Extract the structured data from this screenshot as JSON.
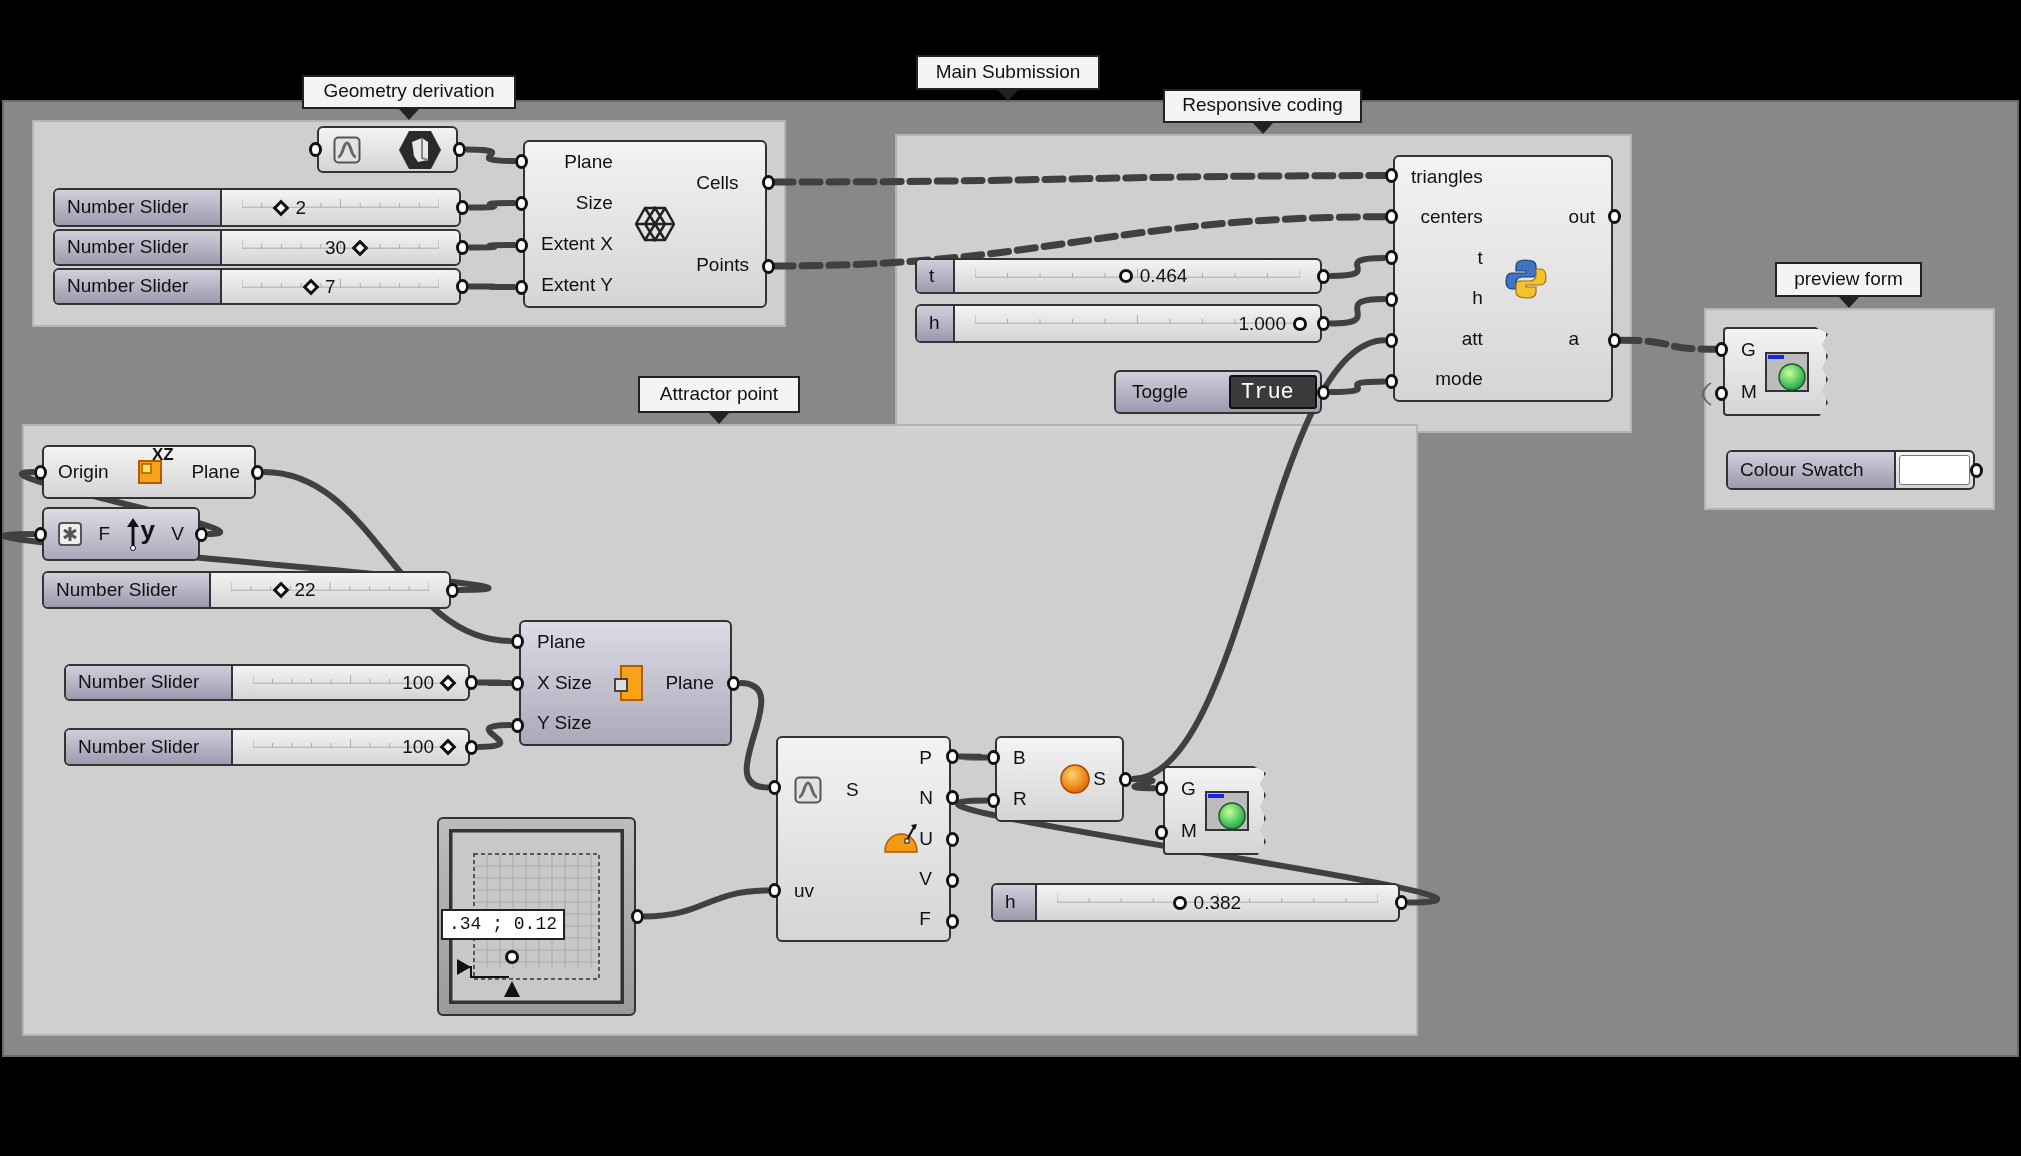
{
  "canvas": {
    "groups": [
      {
        "label": "Main Submission"
      },
      {
        "label": "Geometry derivation"
      },
      {
        "label": "Responsive coding"
      },
      {
        "label": "preview form"
      },
      {
        "label": "Attractor point"
      }
    ],
    "nodes": [
      {
        "kind": "param"
      },
      {
        "kind": "int_slider",
        "label": "Number Slider",
        "value": "2"
      },
      {
        "kind": "int_slider",
        "label": "Number Slider",
        "value": "30"
      },
      {
        "kind": "int_slider",
        "label": "Number Slider",
        "value": "7"
      },
      {
        "kind": "component",
        "inputs": [
          "Plane",
          "Size",
          "Extent X",
          "Extent Y"
        ],
        "outputs": [
          "Cells",
          "Points"
        ]
      },
      {
        "kind": "float_slider",
        "label": "t",
        "value": "0.464"
      },
      {
        "kind": "float_slider",
        "label": "h",
        "value": "1.000"
      },
      {
        "kind": "toggle",
        "label": "Toggle",
        "value": "True",
        "on": true
      },
      {
        "kind": "component",
        "inputs": [
          "triangles",
          "centers",
          "t",
          "h",
          "att",
          "mode"
        ],
        "outputs": [
          "out",
          "a"
        ]
      },
      {
        "kind": "preview",
        "inputs": [
          "G",
          "M"
        ]
      },
      {
        "kind": "swatch",
        "label": "Colour Swatch",
        "color": "#ffffff"
      },
      {
        "kind": "component",
        "inputs": [
          "Origin"
        ],
        "outputs": [
          "Plane"
        ],
        "icon_text": "XZ"
      },
      {
        "kind": "component",
        "inputs": [
          "F"
        ],
        "outputs": [
          "V"
        ],
        "icon_text": "y"
      },
      {
        "kind": "int_slider",
        "label": "Number Slider",
        "value": "22"
      },
      {
        "kind": "int_slider",
        "label": "Number Slider",
        "value": "100"
      },
      {
        "kind": "int_slider",
        "label": "Number Slider",
        "value": "100"
      },
      {
        "kind": "component",
        "inputs": [
          "Plane",
          "X Size",
          "Y Size"
        ],
        "outputs": [
          "Plane"
        ]
      },
      {
        "kind": "component",
        "inputs": [
          "S",
          "uv"
        ],
        "outputs": [
          "P",
          "N",
          "U",
          "V",
          "F"
        ]
      },
      {
        "kind": "component",
        "inputs": [
          "B",
          "R"
        ],
        "outputs": [
          "S"
        ]
      },
      {
        "kind": "preview",
        "inputs": [
          "G",
          "M"
        ]
      },
      {
        "kind": "float_slider",
        "label": "h",
        "value": "0.382"
      },
      {
        "kind": "md_slider",
        "value": ".34 ; 0.12"
      }
    ]
  }
}
